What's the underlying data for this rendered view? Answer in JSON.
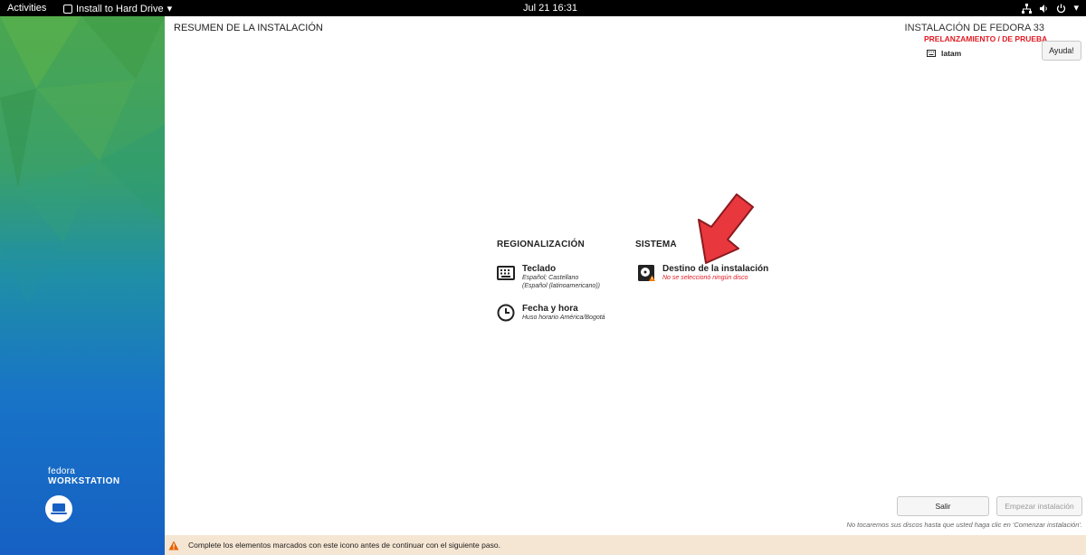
{
  "topbar": {
    "activities": "Activities",
    "app_name": "Install to Hard Drive",
    "clock": "Jul 21  16:31",
    "tray_icons": [
      "network-icon",
      "volume-icon",
      "power-icon",
      "chevron-down-icon"
    ]
  },
  "sidebar": {
    "brand_line1": "fedora",
    "brand_line2": "WORKSTATION"
  },
  "header": {
    "title": "RESUMEN DE LA INSTALACIÓN",
    "product": "INSTALACIÓN DE FEDORA 33",
    "prerelease": "PRELANZAMIENTO / DE PRUEBA",
    "keyboard_layout": "latam",
    "help_label": "Ayuda!"
  },
  "sections": {
    "localization": {
      "title": "REGIONALIZACIÓN",
      "keyboard": {
        "name": "Teclado",
        "status_line1": "Español; Castellano",
        "status_line2": "(Español (latinoamericano))"
      },
      "datetime": {
        "name": "Fecha y hora",
        "status": "Huso horario América/Bogotá"
      }
    },
    "system": {
      "title": "SISTEMA",
      "destination": {
        "name": "Destino de la instalación",
        "status": "No se seleccionó ningún disco"
      }
    }
  },
  "footer": {
    "quit_label": "Salir",
    "begin_label": "Empezar instalación",
    "note": "No tocaremos sus discos hasta que usted haga clic en 'Comenzar instalación'.",
    "warning": "Complete los elementos marcados con este icono antes de continuar con el siguiente paso."
  },
  "colors": {
    "error": "#e01b24",
    "warning_bar": "#f5e6d3",
    "arrow": "#e8383d"
  }
}
